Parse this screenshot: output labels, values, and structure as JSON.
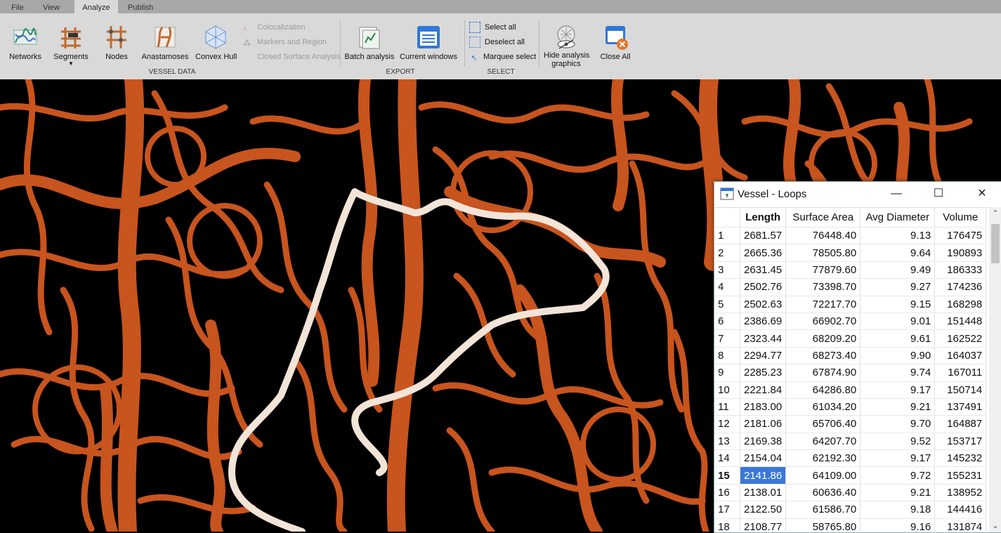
{
  "tabs": [
    {
      "label": "File"
    },
    {
      "label": "View"
    },
    {
      "label": "Analyze"
    },
    {
      "label": "Publish"
    }
  ],
  "ribbon": {
    "networks": "Networks",
    "segments": "Segments",
    "nodes": "Nodes",
    "anastamoses": "Anastamoses",
    "convex_hull": "Convex Hull",
    "colocalization": "Colocalization",
    "markers_region": "Markers and Region",
    "closed_surface": "Closed Surface Analysis",
    "vessel_data_label": "VESSEL DATA",
    "batch_analysis": "Batch analysis",
    "current_windows": "Current windows",
    "export_label": "EXPORT",
    "select_all": "Select all",
    "deselect_all": "Deselect all",
    "marquee_select": "Marquee select",
    "select_label": "SELECT",
    "hide_analysis_1": "Hide analysis",
    "hide_analysis_2": "graphics",
    "close_all": "Close All"
  },
  "colors": {
    "vessel": "#c8541e",
    "loop": "#f3e4d8",
    "selected": "#3a78d8"
  },
  "window": {
    "title": "Vessel - Loops",
    "columns": [
      "Length",
      "Surface Area",
      "Avg Diameter",
      "Volume"
    ],
    "rows": [
      [
        "1",
        "2681.57",
        "76448.40",
        "9.13",
        "176475"
      ],
      [
        "2",
        "2665.36",
        "78505.80",
        "9.64",
        "190893"
      ],
      [
        "3",
        "2631.45",
        "77879.60",
        "9.49",
        "186333"
      ],
      [
        "4",
        "2502.76",
        "73398.70",
        "9.27",
        "174236"
      ],
      [
        "5",
        "2502.63",
        "72217.70",
        "9.15",
        "168298"
      ],
      [
        "6",
        "2386.69",
        "66902.70",
        "9.01",
        "151448"
      ],
      [
        "7",
        "2323.44",
        "68209.20",
        "9.61",
        "162522"
      ],
      [
        "8",
        "2294.77",
        "68273.40",
        "9.90",
        "164037"
      ],
      [
        "9",
        "2285.23",
        "67874.90",
        "9.74",
        "167011"
      ],
      [
        "10",
        "2221.84",
        "64286.80",
        "9.17",
        "150714"
      ],
      [
        "11",
        "2183.00",
        "61034.20",
        "9.21",
        "137491"
      ],
      [
        "12",
        "2181.06",
        "65706.40",
        "9.70",
        "164887"
      ],
      [
        "13",
        "2169.38",
        "64207.70",
        "9.52",
        "153717"
      ],
      [
        "14",
        "2154.04",
        "62192.30",
        "9.17",
        "145232"
      ],
      [
        "15",
        "2141.86",
        "64109.00",
        "9.72",
        "155231"
      ],
      [
        "16",
        "2138.01",
        "60636.40",
        "9.21",
        "138952"
      ],
      [
        "17",
        "2122.50",
        "61586.70",
        "9.18",
        "144416"
      ],
      [
        "18",
        "2108.77",
        "58765.80",
        "9.16",
        "131874"
      ]
    ],
    "selected_row": 15
  }
}
